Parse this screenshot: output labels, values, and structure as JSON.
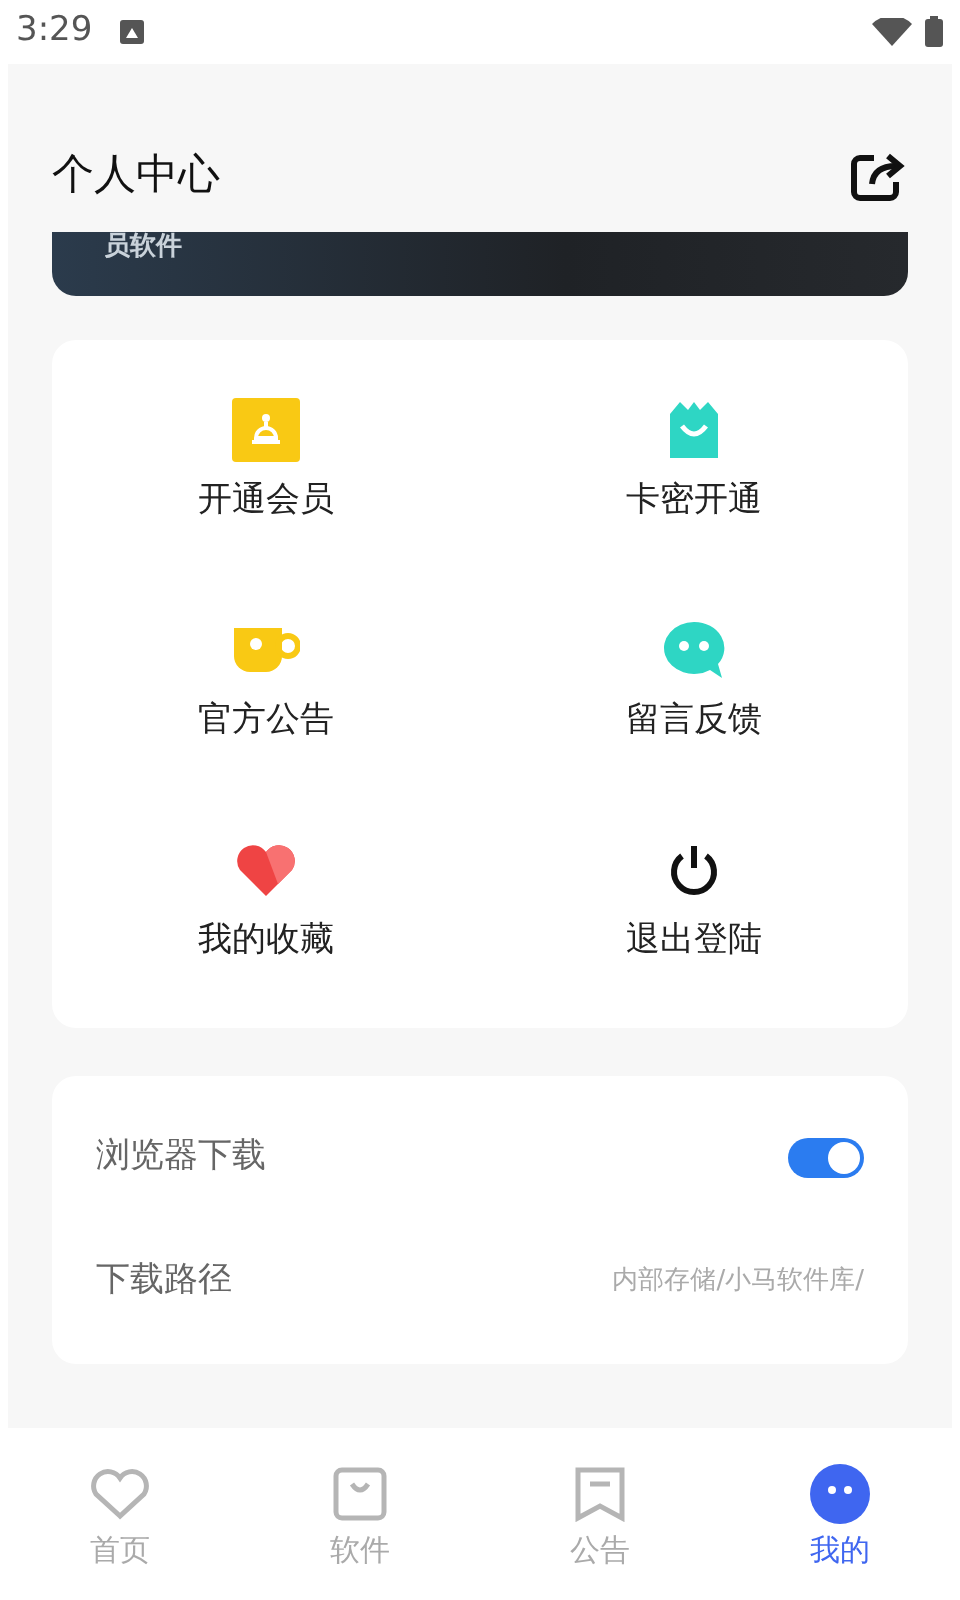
{
  "status_bar": {
    "time": "3:29"
  },
  "header": {
    "title": "个人中心"
  },
  "banner": {
    "text": "员软件"
  },
  "menu": [
    {
      "label": "开通会员",
      "kind": "vip"
    },
    {
      "label": "卡密开通",
      "kind": "bag"
    },
    {
      "label": "官方公告",
      "kind": "cup"
    },
    {
      "label": "留言反馈",
      "kind": "chat"
    },
    {
      "label": "我的收藏",
      "kind": "heart"
    },
    {
      "label": "退出登陆",
      "kind": "power"
    }
  ],
  "settings": [
    {
      "label": "浏览器下载",
      "kind": "toggle",
      "on": true
    },
    {
      "label": "下载路径",
      "kind": "value",
      "value": "内部存储/小马软件库/"
    }
  ],
  "tabs": [
    {
      "label": "首页",
      "kind": "heart",
      "selected": false
    },
    {
      "label": "软件",
      "kind": "bag",
      "selected": false
    },
    {
      "label": "公告",
      "kind": "note",
      "selected": false
    },
    {
      "label": "我的",
      "kind": "face",
      "selected": true
    }
  ]
}
